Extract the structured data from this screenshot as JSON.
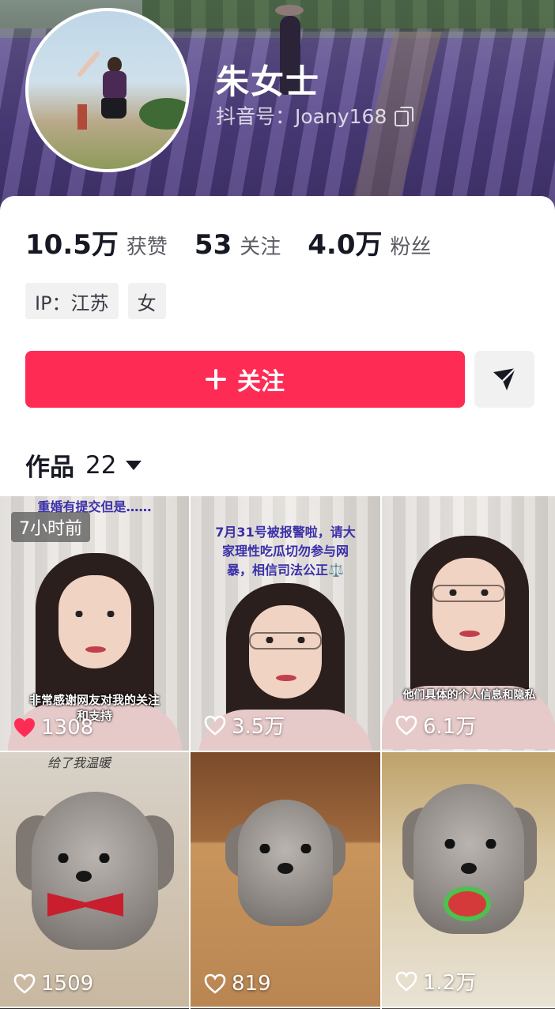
{
  "profile": {
    "name": "朱女士",
    "douyin_id": "抖音号：Joany168"
  },
  "stats": [
    {
      "value": "10.5万",
      "label": "获赞"
    },
    {
      "value": "53",
      "label": "关注"
    },
    {
      "value": "4.0万",
      "label": "粉丝"
    }
  ],
  "tags": [
    "IP：江苏",
    "女"
  ],
  "actions": {
    "follow_label": "关注"
  },
  "works": {
    "label": "作品",
    "count": "22"
  },
  "videos": [
    {
      "time": "7小时前",
      "caption_top": "重婚有提交但是……",
      "caption_bottom": "非常感谢网友对我的关注和支持",
      "likes": "1308",
      "liked": true
    },
    {
      "caption_top": "7月31号被报警啦，请大家理性吃瓜切勿参与网暴，相信司法公正⚖️",
      "likes": "3.5万",
      "liked": false
    },
    {
      "caption_bottom": "他们具体的个人信息和隐私",
      "likes": "6.1万",
      "liked": false
    },
    {
      "caption_top": "给了我温暖",
      "likes": "1509",
      "liked": false
    },
    {
      "likes": "819",
      "liked": false
    },
    {
      "likes": "1.2万",
      "liked": false
    }
  ],
  "colors": {
    "accent": "#fe2c55",
    "liked_heart": "#fe2c55"
  }
}
